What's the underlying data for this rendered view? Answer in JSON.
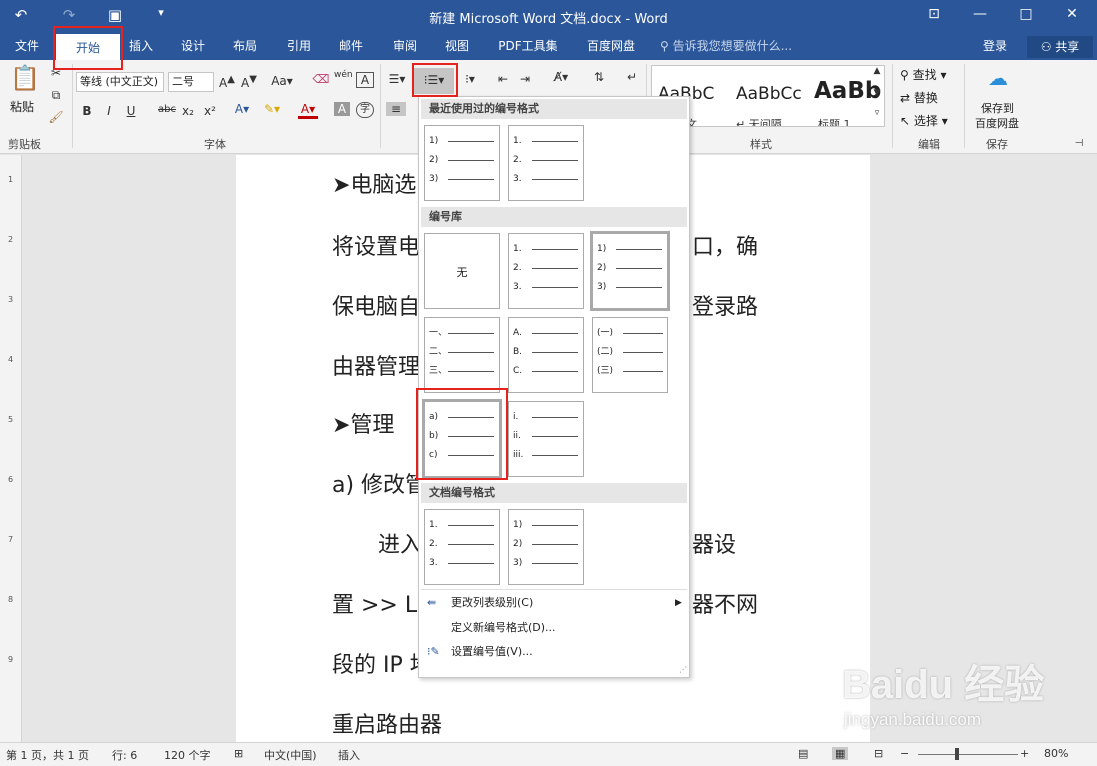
{
  "title_bar": {
    "title": "新建 Microsoft Word 文档.docx - Word",
    "undo_icon": "undo-icon",
    "redo_icon": "redo-icon",
    "save_icon": "save-icon"
  },
  "tabs": [
    "文件",
    "开始",
    "插入",
    "设计",
    "布局",
    "引用",
    "邮件",
    "审阅",
    "视图",
    "PDF工具集",
    "百度网盘"
  ],
  "active_tab": "开始",
  "tell_me": "告诉我您想要做什么...",
  "login": "登录",
  "share": "共享",
  "ribbon": {
    "clipboard": {
      "paste": "粘贴",
      "label": "剪贴板"
    },
    "font": {
      "name": "等线 (中文正文)",
      "size": "二号",
      "label": "字体"
    },
    "styles": {
      "label": "样式",
      "items": [
        {
          "preview": "AaBbC",
          "name": "文"
        },
        {
          "preview": "AaBbCc",
          "name": "无间隔"
        },
        {
          "preview": "AaBb",
          "name": "标题 1"
        }
      ]
    },
    "editing": {
      "find": "查找",
      "replace": "替换",
      "select": "选择",
      "label": "编辑"
    },
    "save": {
      "line1": "保存到",
      "line2": "百度网盘",
      "label": "保存"
    }
  },
  "document": {
    "lines": [
      "➤电脑选",
      "将设置电",
      "口，确",
      "保电脑自",
      "登录路",
      "由器管理",
      "➤管理",
      "a) 修改管",
      "进入",
      "器设",
      "置  >> L",
      "器不网",
      "段的 IP 地",
      "重启路由器"
    ]
  },
  "dropdown": {
    "recent_title": "最近使用过的编号格式",
    "library_title": "编号库",
    "document_title": "文档编号格式",
    "none_label": "无",
    "recent": [
      [
        "1)",
        "2)",
        "3)"
      ],
      [
        "1.",
        "2.",
        "3."
      ]
    ],
    "library": [
      [
        "1.",
        "2.",
        "3."
      ],
      [
        "1)",
        "2)",
        "3)"
      ],
      [
        "一、",
        "二、",
        "三、"
      ],
      [
        "A.",
        "B.",
        "C."
      ],
      [
        "(一)",
        "(二)",
        "(三)"
      ],
      [
        "a)",
        "b)",
        "c)"
      ],
      [
        "i.",
        "ii.",
        "iii."
      ]
    ],
    "document_formats": [
      [
        "1.",
        "2.",
        "3."
      ],
      [
        "1)",
        "2)",
        "3)"
      ]
    ],
    "menu": [
      "更改列表级别(C)",
      "定义新编号格式(D)...",
      "设置编号值(V)..."
    ]
  },
  "status": {
    "page": "第 1 页，共 1 页",
    "words": "行: 6",
    "chars": "120 个字",
    "lang": "中文(中国)",
    "mode": "插入",
    "zoom": "80%"
  },
  "watermark": {
    "brand": "Baidu 经验",
    "url": "jingyan.baidu.com"
  },
  "colors": {
    "accent": "#2b579a",
    "highlight": "#e5221d"
  }
}
